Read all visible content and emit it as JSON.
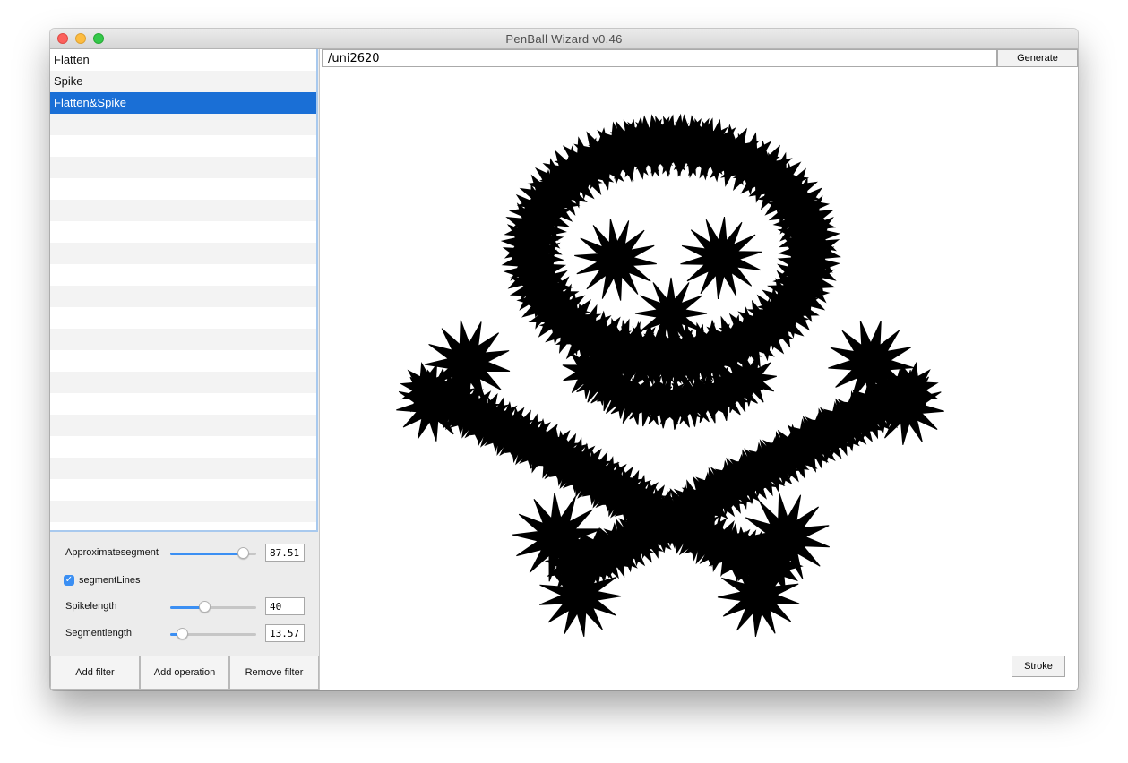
{
  "window": {
    "title": "PenBall Wizard v0.46"
  },
  "filters": {
    "items": [
      {
        "label": "Flatten",
        "selected": false
      },
      {
        "label": "Spike",
        "selected": false
      },
      {
        "label": "Flatten&Spike",
        "selected": true
      }
    ]
  },
  "params": {
    "approx": {
      "label": "Approximatesegment",
      "value": "87.51",
      "fraction": 0.84
    },
    "segmentLines": {
      "label": "segmentLines",
      "checked": true
    },
    "spike": {
      "label": "Spikelength",
      "value": "40",
      "fraction": 0.4
    },
    "segment": {
      "label": "Segmentlength",
      "value": "13.57",
      "fraction": 0.14
    }
  },
  "buttons": {
    "add_filter": "Add filter",
    "add_operation": "Add operation",
    "remove_filter": "Remove filter",
    "generate": "Generate",
    "stroke": "Stroke"
  },
  "glyph": {
    "name": "/uni2620"
  },
  "colors": {
    "selection": "#1a6fd6",
    "slider": "#3b8ff3"
  }
}
